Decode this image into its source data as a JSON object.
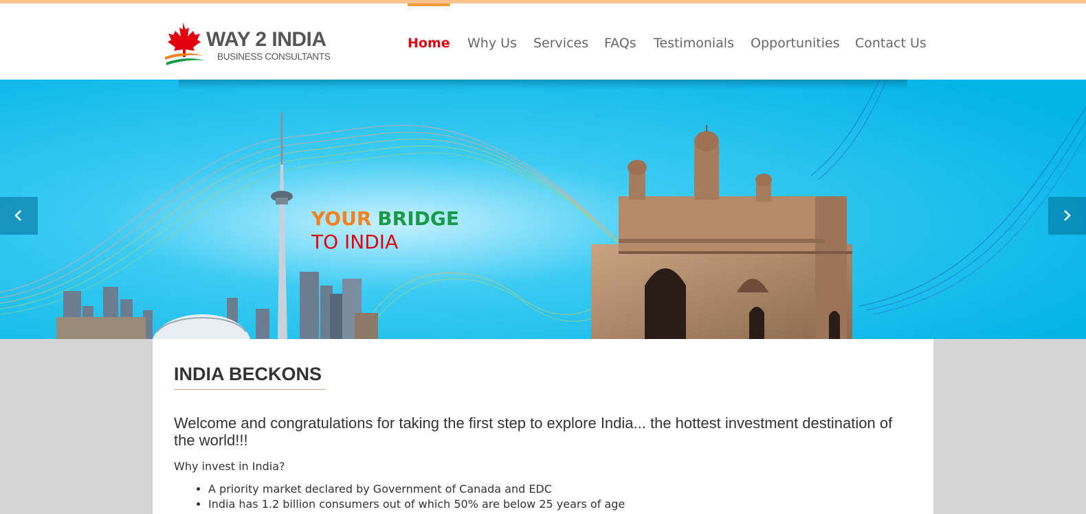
{
  "header": {
    "logo": {
      "title": "WAY 2 INDIA",
      "subtitle": "BUSINESS CONSULTANTS",
      "icon": "maple-leaf-icon"
    },
    "nav": [
      {
        "label": "Home",
        "active": true
      },
      {
        "label": "Why Us"
      },
      {
        "label": "Services"
      },
      {
        "label": "FAQs"
      },
      {
        "label": "Testimonials"
      },
      {
        "label": "Opportunities"
      },
      {
        "label": "Contact Us"
      }
    ]
  },
  "hero": {
    "tagline": {
      "your": "YOUR",
      "bridge": "BRIDGE",
      "to_india": "TO INDIA"
    },
    "prev_icon": "chevron-left-icon",
    "next_icon": "chevron-right-icon"
  },
  "content": {
    "heading": "INDIA BECKONS",
    "lead": "Welcome and congratulations for taking the first step to explore India... the hottest investment destination of the world!!!",
    "why": "Why invest in India?",
    "bullets": [
      "A priority market declared by Government of Canada and EDC",
      "India has 1.2 billion consumers out of which 50% are below 25 years of age"
    ]
  },
  "colors": {
    "accent": "#f39b3c",
    "nav_active": "#e1000e",
    "tag_orange": "#f58220",
    "tag_green": "#1a9a48",
    "hero_sky": "#0bbde9"
  }
}
